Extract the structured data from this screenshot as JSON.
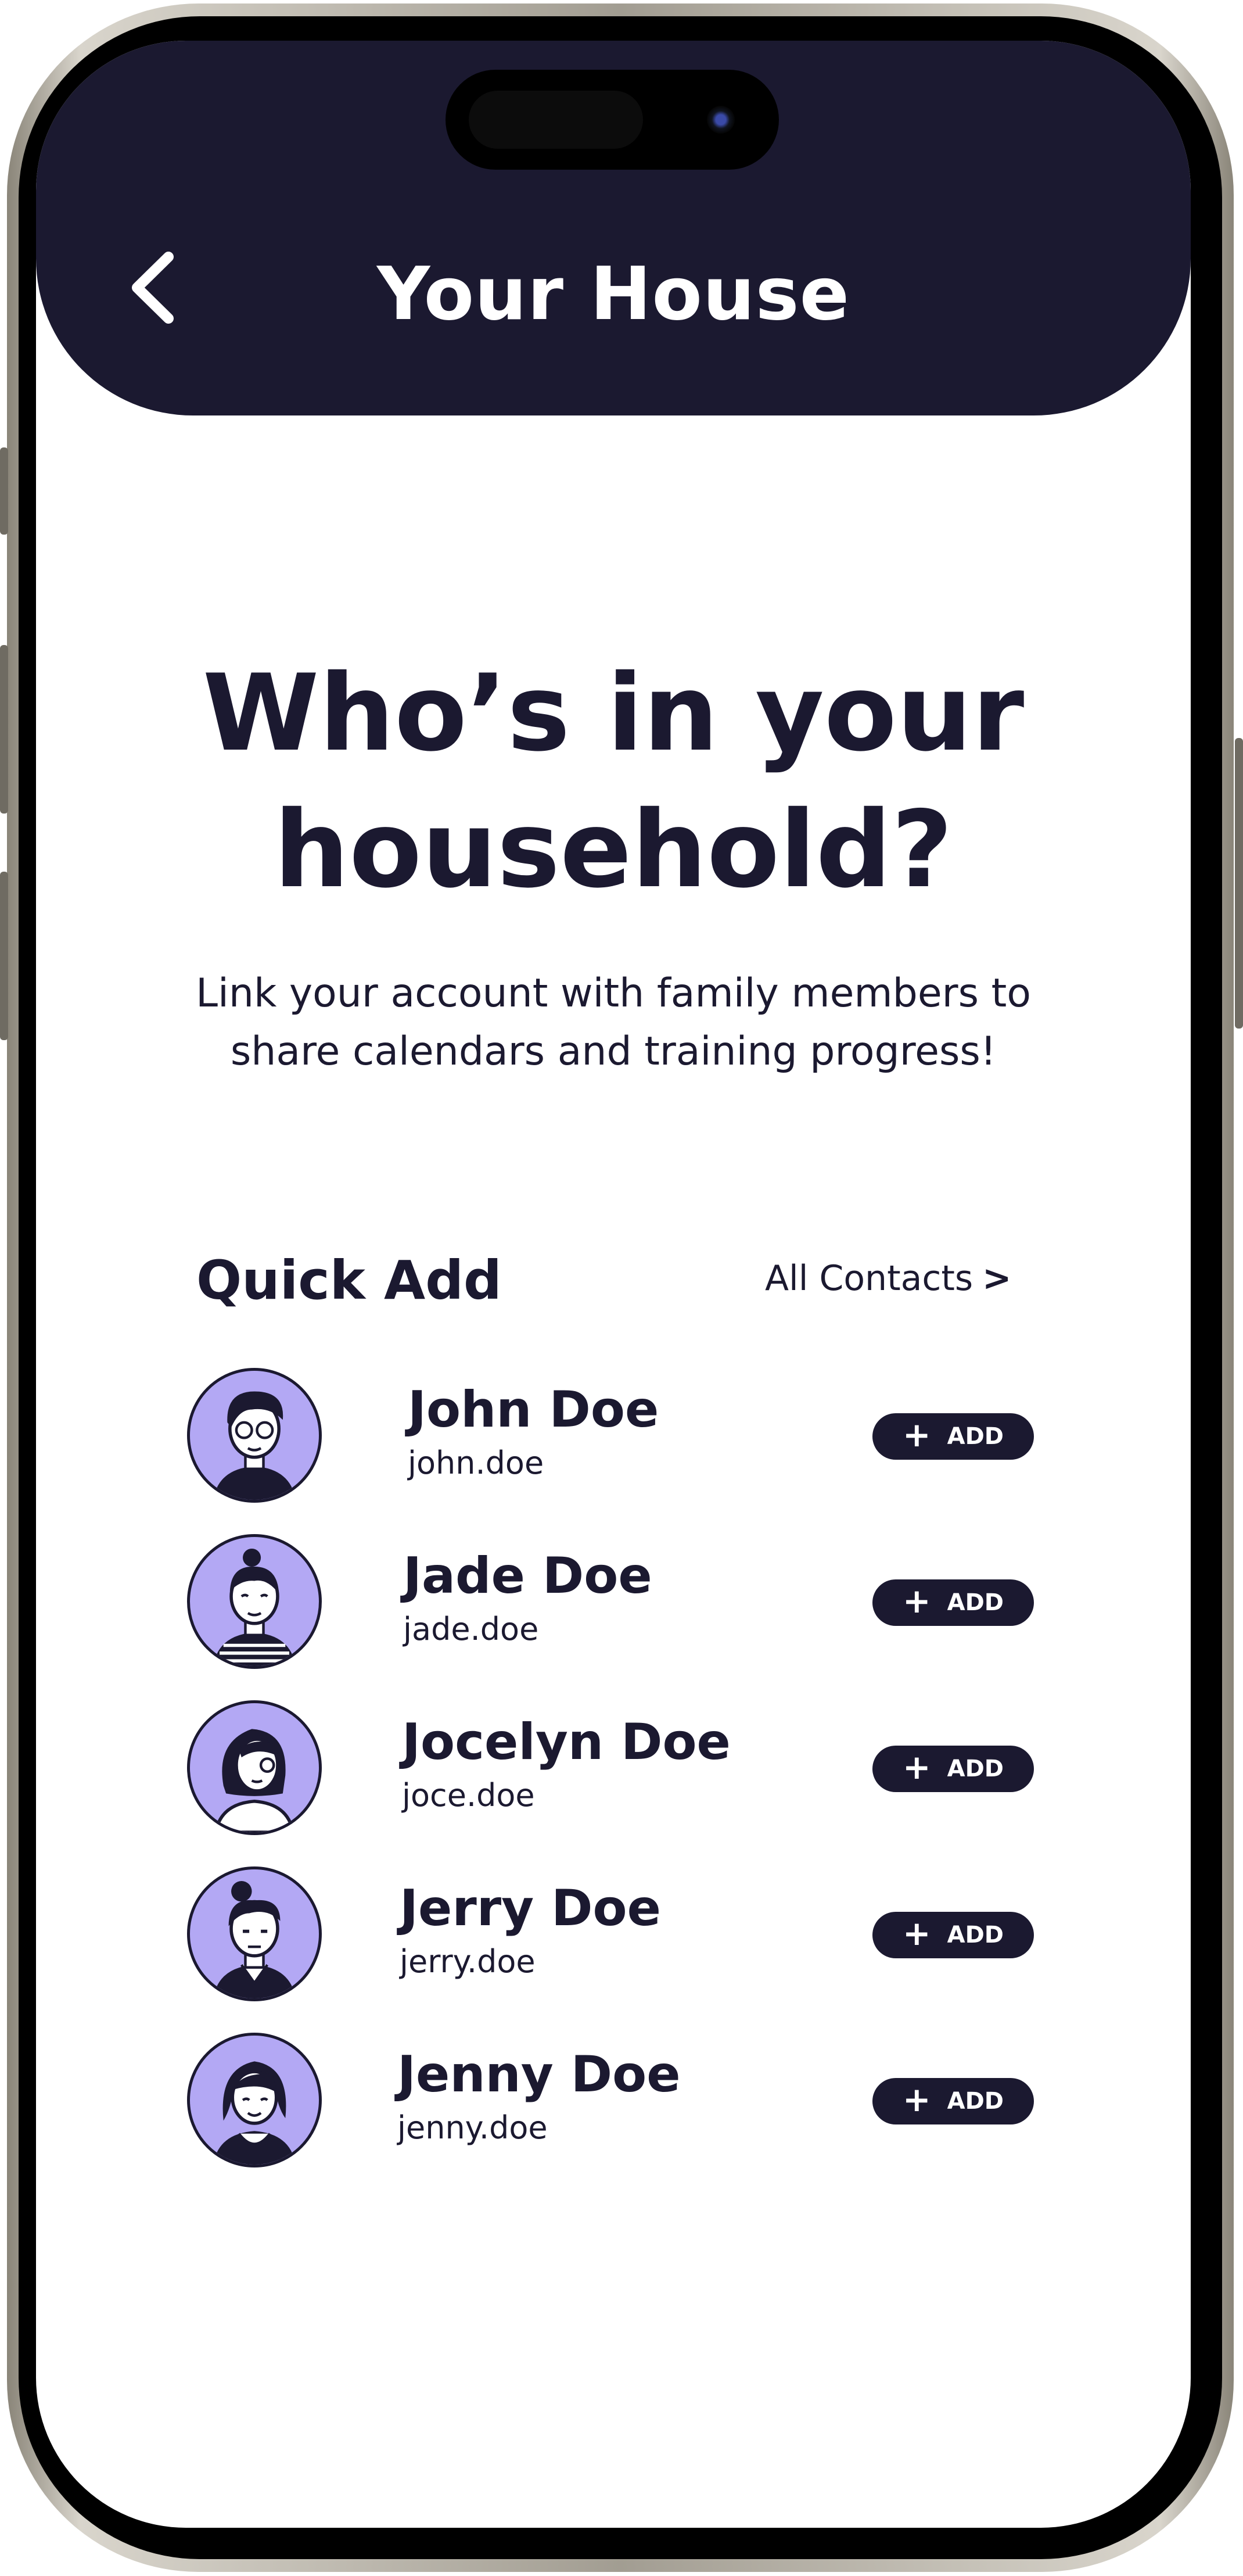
{
  "header": {
    "title": "Your House"
  },
  "main": {
    "headline_line1": "Who’s in your",
    "headline_line2": "household?",
    "subtitle_line1": "Link your account with family members to",
    "subtitle_line2": "share calendars and training progress!"
  },
  "quick_add": {
    "title": "Quick Add",
    "all_contacts_label": "All Contacts",
    "all_contacts_chevron": ">",
    "add_label": "ADD",
    "add_icon": "+",
    "contacts": [
      {
        "name": "John Doe",
        "handle": "john.doe"
      },
      {
        "name": "Jade Doe",
        "handle": "jade.doe"
      },
      {
        "name": "Jocelyn Doe",
        "handle": "joce.doe"
      },
      {
        "name": "Jerry Doe",
        "handle": "jerry.doe"
      },
      {
        "name": "Jenny Doe",
        "handle": "jenny.doe"
      }
    ]
  },
  "colors": {
    "header_bg": "#1b1930",
    "accent_avatar": "#b3a8f4",
    "text": "#1b1930",
    "button_bg": "#1b1930"
  },
  "icons": {
    "back": "chevron-left-icon",
    "add": "plus-icon",
    "all_contacts": "chevron-right-icon"
  }
}
